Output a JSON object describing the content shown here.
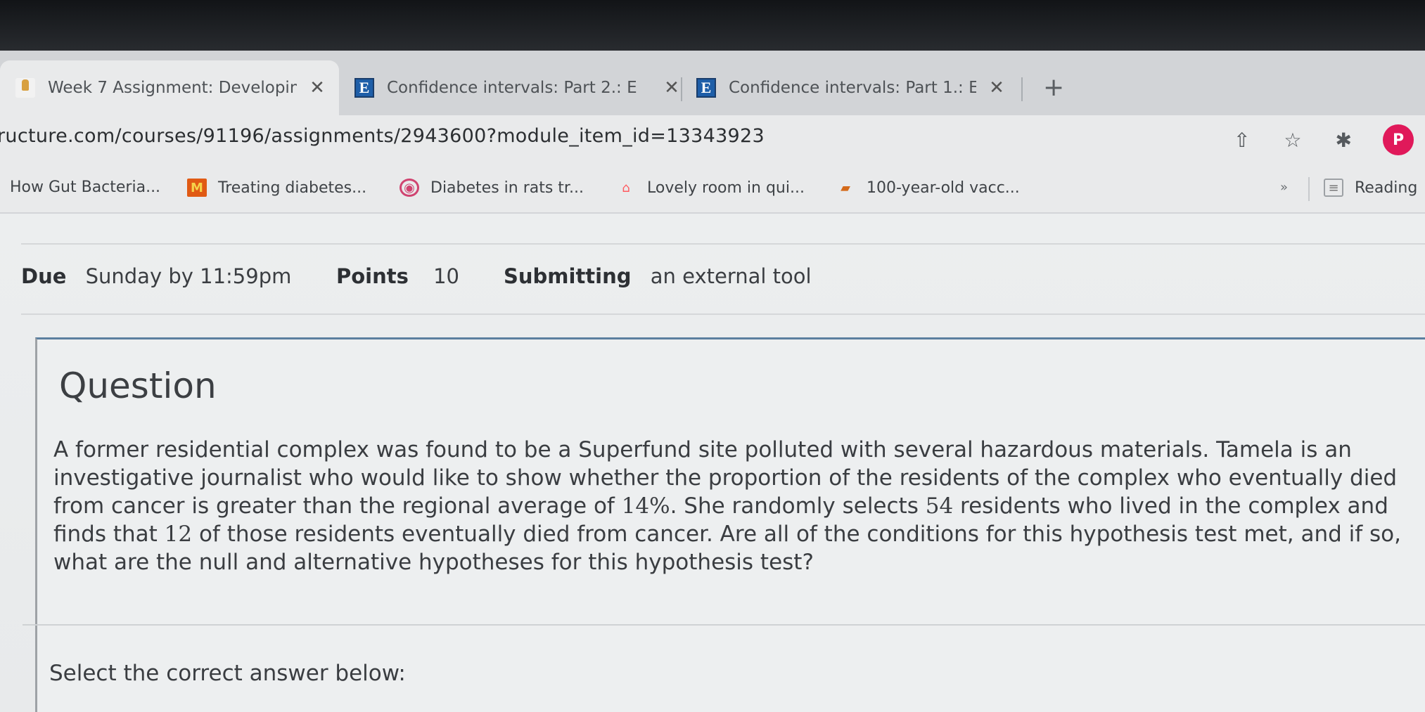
{
  "tabs": [
    {
      "title": "Week 7 Assignment: Developin",
      "favicon": "canvas-icon",
      "active": true
    },
    {
      "title": "Confidence intervals: Part 2.: E",
      "favicon": "e-logo-icon",
      "active": false
    },
    {
      "title": "Confidence intervals: Part 1.: E",
      "favicon": "e-logo-icon",
      "active": false
    }
  ],
  "new_tab": "+",
  "address": {
    "url": "ructure.com/courses/91196/assignments/2943600?module_item_id=13343923",
    "profile_initial": "P"
  },
  "bookmarks": [
    {
      "label": "How Gut Bacteria...",
      "icon": ""
    },
    {
      "label": "Treating diabetes...",
      "icon": "M"
    },
    {
      "label": "Diabetes in rats tr...",
      "icon": "circle-icon"
    },
    {
      "label": "Lovely room in qui...",
      "icon": "airbnb-icon"
    },
    {
      "label": "100-year-old vacc...",
      "icon": "dog-icon"
    }
  ],
  "bookmarks_more": "»",
  "reading_list": "Reading",
  "assignment_meta": {
    "due_label": "Due",
    "due_value": "Sunday by 11:59pm",
    "points_label": "Points",
    "points_value": "10",
    "submitting_label": "Submitting",
    "submitting_value": "an external tool"
  },
  "question": {
    "heading": "Question",
    "line1": "A former residential complex was found to be a Superfund site polluted with several hazardous materials. Tamela is an",
    "line2": "investigative journalist who would like to show whether the proportion of the residents of the complex who eventually died",
    "line3_a": "from cancer is greater than the regional average of ",
    "line3_pct": "14%",
    "line3_b": ". She randomly selects ",
    "line3_n": "54",
    "line3_c": " residents who lived in the complex and",
    "line4_a": "finds that ",
    "line4_x": "12",
    "line4_b": " of those residents eventually died from cancer. Are all of the conditions for this hypothesis test met, and if so,",
    "line5": "what are the null and alternative hypotheses for this hypothesis test?",
    "prompt": "Select the correct answer below:"
  }
}
